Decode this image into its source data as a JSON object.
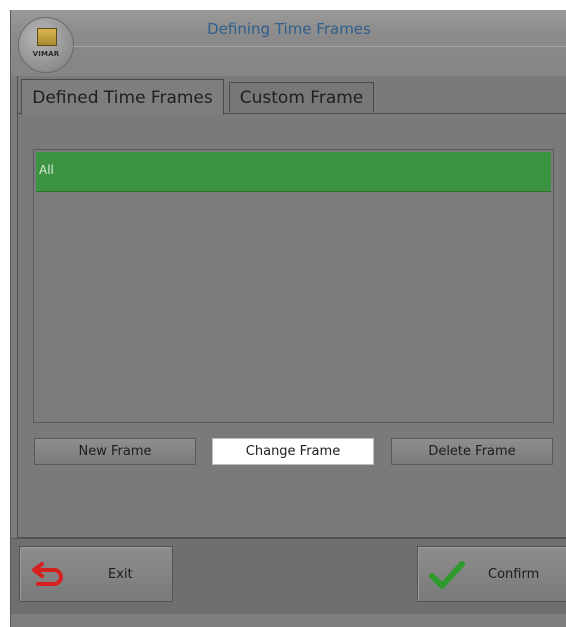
{
  "window": {
    "title": "Defining Time Frames",
    "logo_text": "VIMAR"
  },
  "tabs": [
    {
      "label": "Defined Time Frames",
      "active": true
    },
    {
      "label": "Custom Frame",
      "active": false
    }
  ],
  "frames_list": {
    "items": [
      {
        "label": "All",
        "selected": true
      }
    ]
  },
  "actions": {
    "new_label": "New Frame",
    "change_label": "Change Frame",
    "delete_label": "Delete Frame"
  },
  "footer": {
    "exit_label": "Exit",
    "confirm_label": "Confirm"
  },
  "colors": {
    "selection": "#3c9442",
    "title_text": "#2f5f8c",
    "exit_icon": "#d62020",
    "confirm_icon": "#2e9a2e"
  },
  "icons": {
    "exit": "return-arrow-icon",
    "confirm": "checkmark-icon"
  }
}
